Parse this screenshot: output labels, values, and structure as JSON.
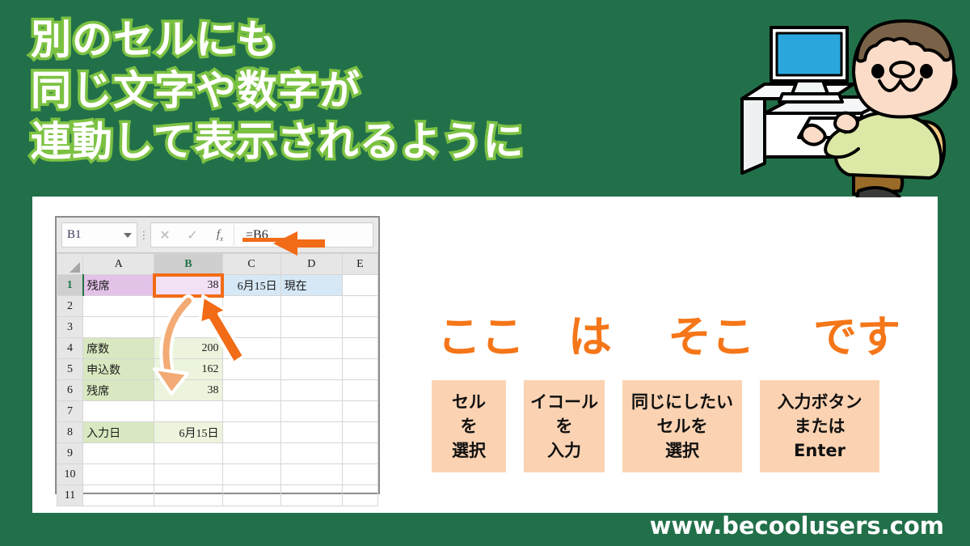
{
  "theme": {
    "bg_green": "#22704a",
    "accent_orange": "#f26b16",
    "title_outline_green": "#7cc242",
    "step_box_peach": "#fbd3b2"
  },
  "title": {
    "line1": "別のセルにも",
    "line2": "同じ文字や数字が",
    "line3": "連動して表示されるように"
  },
  "illustration": {
    "name": "person-at-computer-illustration",
    "alt": "A man sitting at a desk typing on a computer keyboard"
  },
  "excel": {
    "name_box": "B1",
    "name_box_caret": "chevron-down-icon",
    "cancel_icon": "✕",
    "confirm_icon": "✓",
    "fx_icon": "fx",
    "formula": "=B6",
    "columns": [
      "A",
      "B",
      "C",
      "D",
      "E"
    ],
    "selected_column": "B",
    "selected_row": "1",
    "rows": [
      {
        "n": "1",
        "a": "残席",
        "b": "38",
        "c": "6月15日",
        "d": "現在",
        "e": ""
      },
      {
        "n": "2",
        "a": "",
        "b": "",
        "c": "",
        "d": "",
        "e": ""
      },
      {
        "n": "3",
        "a": "",
        "b": "",
        "c": "",
        "d": "",
        "e": ""
      },
      {
        "n": "4",
        "a": "席数",
        "b": "200",
        "c": "",
        "d": "",
        "e": ""
      },
      {
        "n": "5",
        "a": "申込数",
        "b": "162",
        "c": "",
        "d": "",
        "e": ""
      },
      {
        "n": "6",
        "a": "残席",
        "b": "38",
        "c": "",
        "d": "",
        "e": ""
      },
      {
        "n": "7",
        "a": "",
        "b": "",
        "c": "",
        "d": "",
        "e": ""
      },
      {
        "n": "8",
        "a": "入力日",
        "b": "6月15日",
        "c": "",
        "d": "",
        "e": ""
      },
      {
        "n": "9",
        "a": "",
        "b": "",
        "c": "",
        "d": "",
        "e": ""
      },
      {
        "n": "10",
        "a": "",
        "b": "",
        "c": "",
        "d": "",
        "e": ""
      },
      {
        "n": "11",
        "a": "",
        "b": "",
        "c": "",
        "d": "",
        "e": ""
      }
    ]
  },
  "phrase": {
    "w1": "ここ",
    "w2": "は",
    "w3": "そこ",
    "w4": "です"
  },
  "steps": [
    {
      "l1": "セル",
      "l2": "を",
      "l3": "選択"
    },
    {
      "l1": "イコール",
      "l2": "を",
      "l3": "入力"
    },
    {
      "l1": "同じにしたい",
      "l2": "セルを",
      "l3": "選択"
    },
    {
      "l1": "入力ボタン",
      "l2": "または",
      "l3": "Enter"
    }
  ],
  "footer": {
    "url": "www.becoolusers.com"
  }
}
